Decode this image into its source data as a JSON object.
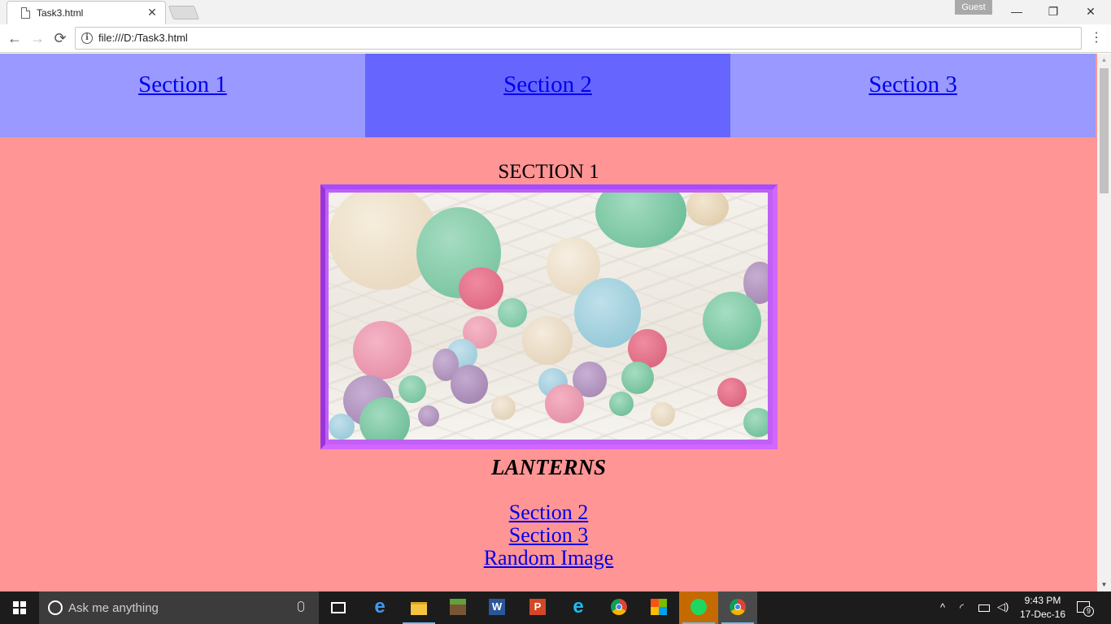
{
  "browser": {
    "tab_title": "Task3.html",
    "tab_close": "✕",
    "profile_label": "Guest",
    "url": "file:///D:/Task3.html",
    "back": "←",
    "forward": "→",
    "reload": "⟳",
    "menu": "⋮",
    "minimize": "—",
    "restore": "❐",
    "close": "✕"
  },
  "page": {
    "nav": [
      {
        "label": "Section 1"
      },
      {
        "label": "Section 2"
      },
      {
        "label": "Section 3"
      }
    ],
    "active_nav_index": 1,
    "section_heading": "SECTION 1",
    "caption": "LANTERNS",
    "links": [
      {
        "label": "Section 2"
      },
      {
        "label": "Section 3"
      },
      {
        "label": "Random Image"
      }
    ],
    "colors": {
      "page_background": "#ff9595",
      "nav_background": "#9999ff",
      "nav_active_background": "#6666ff",
      "link": "#0000ee",
      "frame": "#c060f5"
    }
  },
  "taskbar": {
    "search_placeholder": "Ask me anything",
    "pinned": [
      "task-view-icon",
      "edge-icon",
      "file-explorer-icon",
      "minecraft-icon",
      "word-icon",
      "powerpoint-icon",
      "internet-explorer-icon",
      "chrome-icon",
      "windows-store-icon",
      "spotify-icon",
      "chrome-icon"
    ],
    "time": "9:43 PM",
    "date": "17-Dec-16",
    "notification_count": "9"
  }
}
